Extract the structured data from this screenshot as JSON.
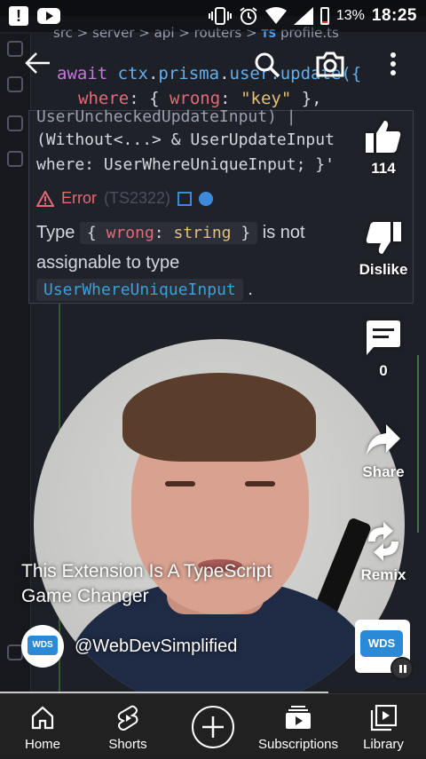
{
  "status_bar": {
    "battery_percent": "13%",
    "time": "18:25",
    "battery_level": 0.13
  },
  "editor": {
    "breadcrumb": [
      "src",
      "server",
      "api",
      "routers"
    ],
    "breadcrumb_file_badge": "TS",
    "breadcrumb_file": "profile.ts",
    "code_line_1": {
      "kw": "await ",
      "obj": "ctx",
      "dot1": ".",
      "prop": "prisma",
      "dot2": ".",
      "tail": "user.update({"
    },
    "code_line_2": {
      "key": "where",
      "colon": ": { ",
      "prop": "wrong",
      "colon2": ": ",
      "str": "\"key\"",
      "end": " },"
    },
    "popup": {
      "line_1": "UserUncheckedUpdateInput) |",
      "line_2": "(Without<...> & UserUpdateInput",
      "line_3": "where: UserWhereUniqueInput; }'",
      "error_label": "Error",
      "error_code": "(TS2322)",
      "msg_type": "Type",
      "chip_open": "{ ",
      "chip_key": "wrong",
      "chip_colon": ": ",
      "chip_type": "string",
      "chip_close": " }",
      "msg_mid": "is not",
      "msg_line2": "assignable to type",
      "chip_target": "UserWhereUniqueInput",
      "msg_end": "."
    }
  },
  "actions": {
    "like_count": "114",
    "dislike_label": "Dislike",
    "comment_count": "0",
    "share_label": "Share",
    "remix_label": "Remix"
  },
  "video": {
    "title_line_1": "This Extension Is A TypeScript",
    "title_line_2": "Game Changer",
    "channel_name": "@WebDevSimplified",
    "channel_logo_text": "WDS"
  },
  "bottom_nav": {
    "home": "Home",
    "shorts": "Shorts",
    "subscriptions": "Subscriptions",
    "library": "Library"
  },
  "colors": {
    "accent_blue": "#2a8ad8",
    "battery_low": "#e53935",
    "nav_bg": "#212121"
  }
}
